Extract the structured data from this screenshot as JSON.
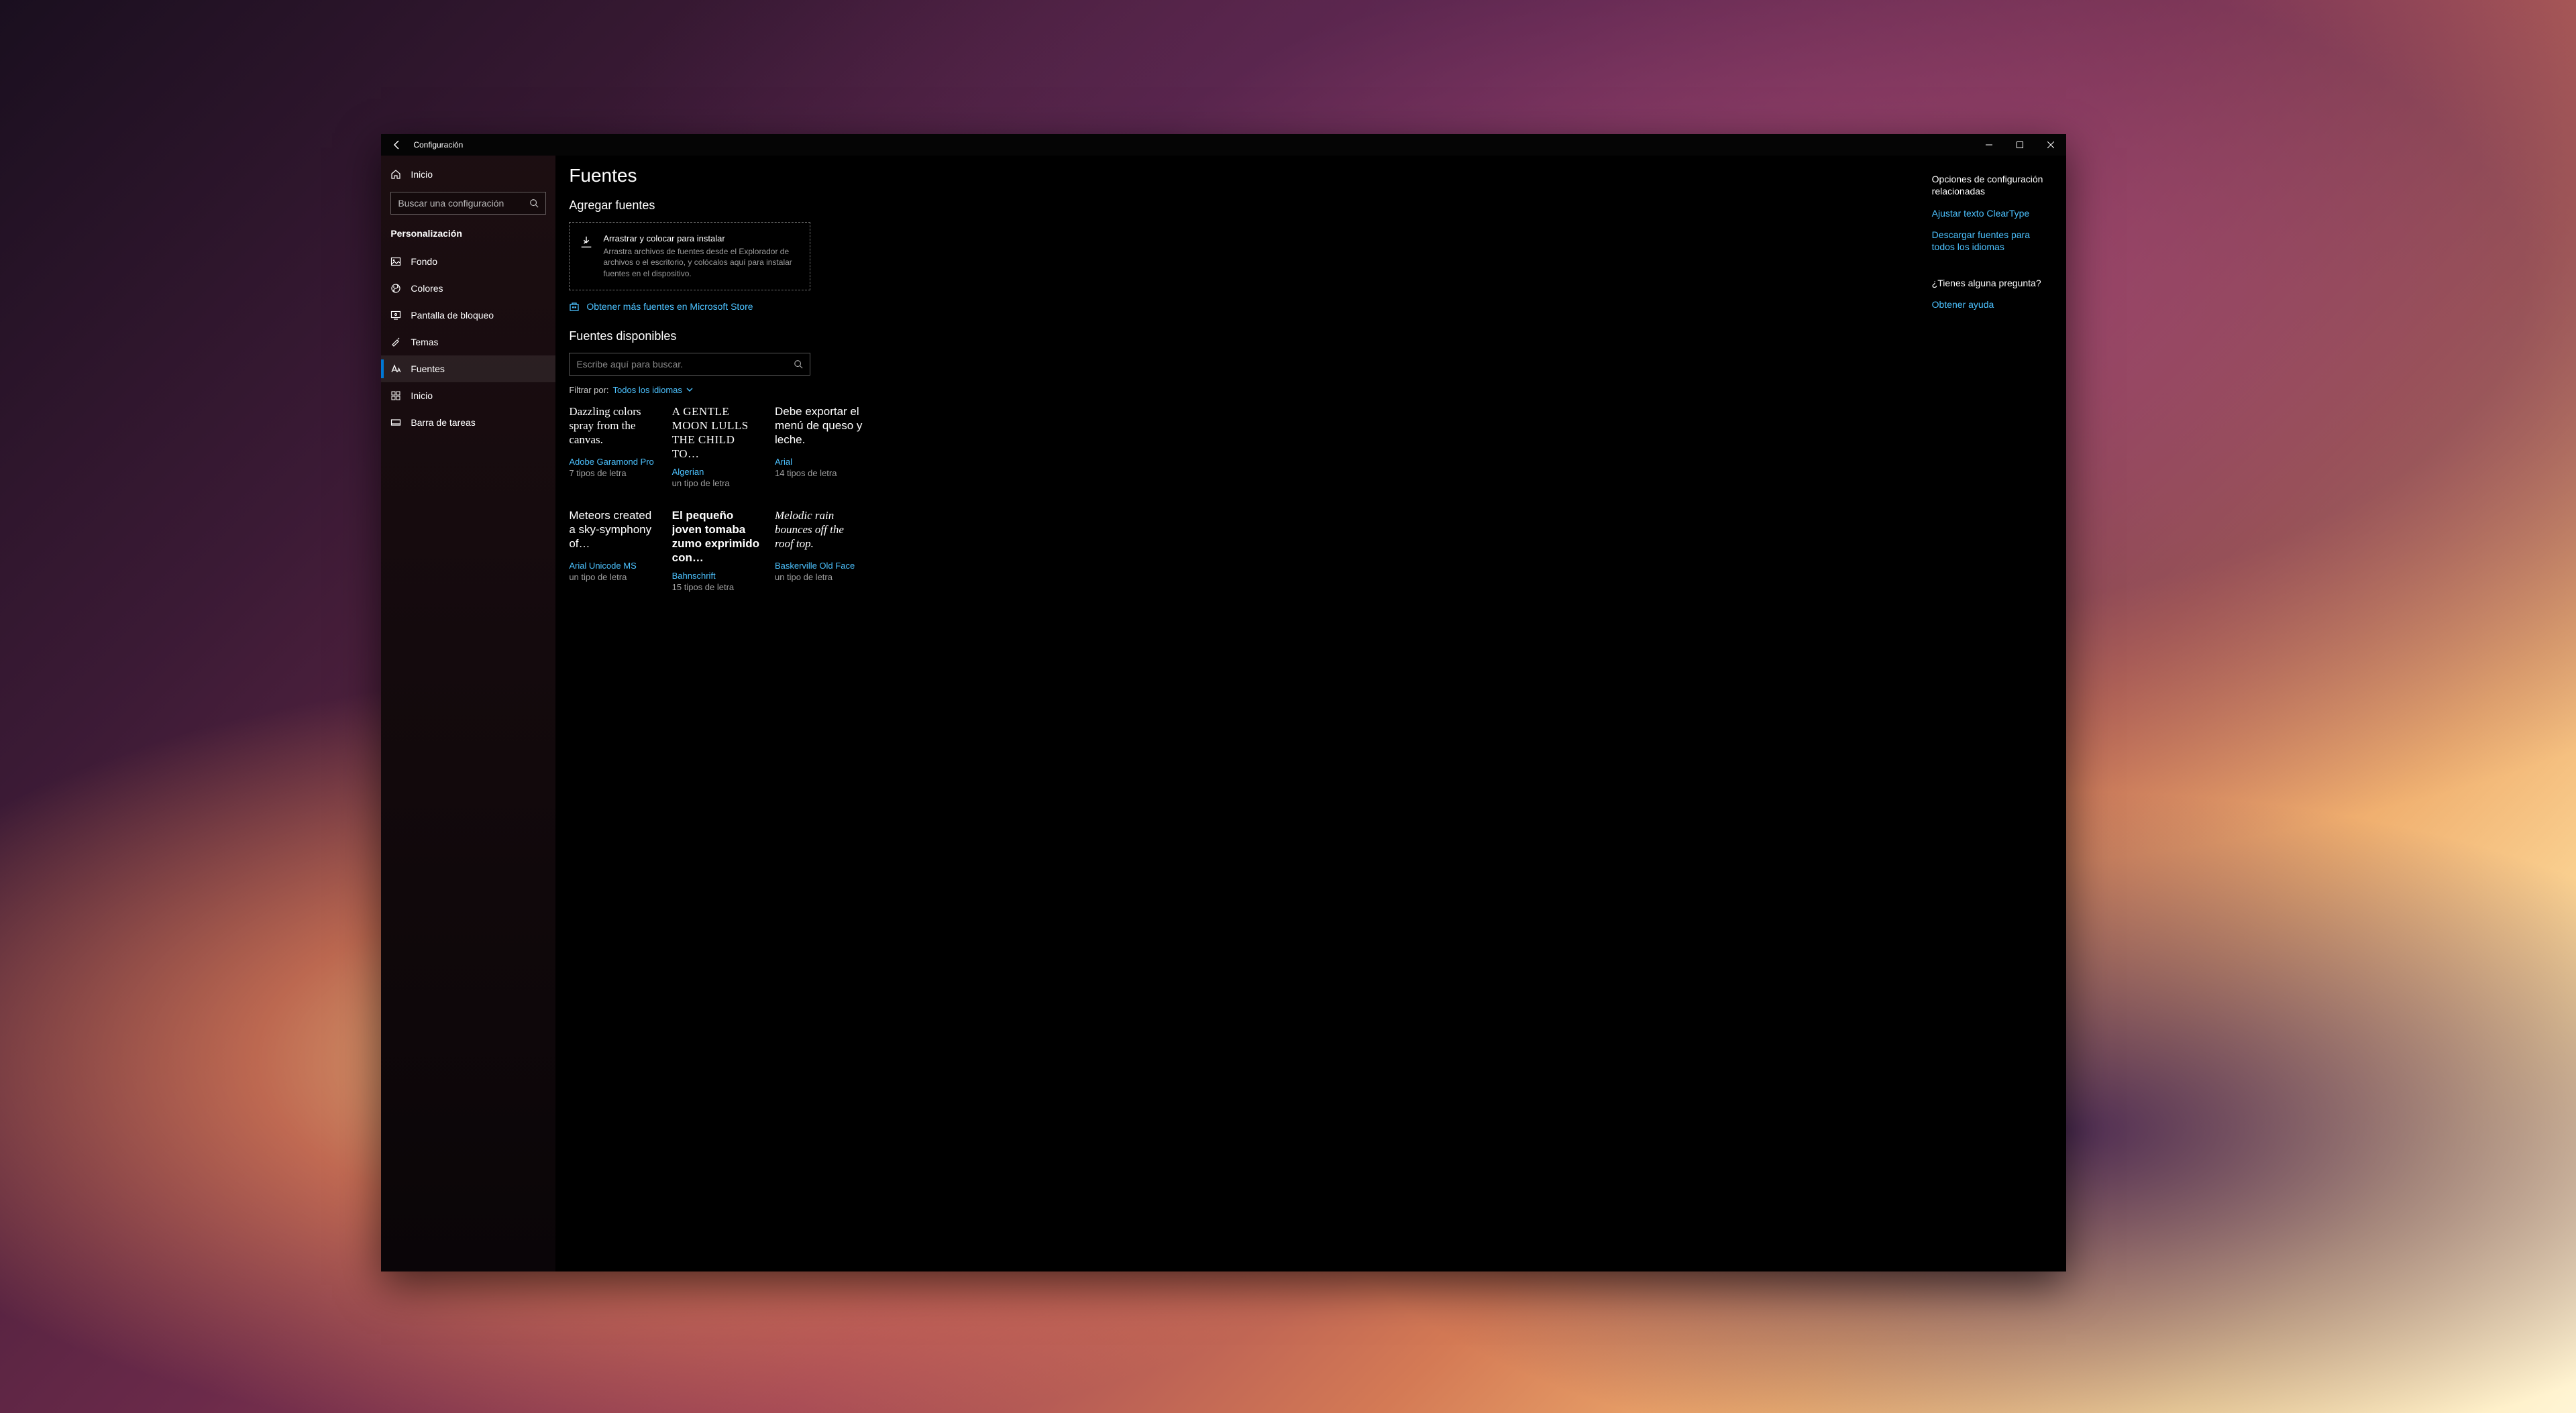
{
  "window": {
    "title": "Configuración"
  },
  "sidebar": {
    "home": "Inicio",
    "search_placeholder": "Buscar una configuración",
    "section": "Personalización",
    "items": [
      {
        "id": "fondo",
        "label": "Fondo"
      },
      {
        "id": "colores",
        "label": "Colores"
      },
      {
        "id": "pantalla",
        "label": "Pantalla de bloqueo"
      },
      {
        "id": "temas",
        "label": "Temas"
      },
      {
        "id": "fuentes",
        "label": "Fuentes"
      },
      {
        "id": "inicio",
        "label": "Inicio"
      },
      {
        "id": "taskbar",
        "label": "Barra de tareas"
      }
    ],
    "active": "fuentes"
  },
  "main": {
    "page_title": "Fuentes",
    "add_fonts_h": "Agregar fuentes",
    "drop_title": "Arrastrar y colocar para instalar",
    "drop_sub": "Arrastra archivos de fuentes desde el Explorador de archivos o el escritorio, y colócalos aquí para instalar fuentes en el dispositivo.",
    "store_link": "Obtener más fuentes en Microsoft Store",
    "available_h": "Fuentes disponibles",
    "font_search_placeholder": "Escribe aquí para buscar.",
    "filter_label": "Filtrar por:",
    "filter_value": "Todos los idiomas",
    "fonts": [
      {
        "sample": "Dazzling colors spray from the canvas.",
        "name": "Adobe Garamond Pro",
        "faces": "7 tipos de letra",
        "class": "ff-garamond"
      },
      {
        "sample": "A gentle moon lulls the child to…",
        "name": "Algerian",
        "faces": "un tipo de letra",
        "class": "ff-algerian"
      },
      {
        "sample": "Debe exportar el menú de queso y leche.",
        "name": "Arial",
        "faces": "14 tipos de letra",
        "class": "ff-arial"
      },
      {
        "sample": "Meteors created a sky-symphony of…",
        "name": "Arial Unicode MS",
        "faces": "un tipo de letra",
        "class": "ff-arialuni"
      },
      {
        "sample": "El pequeño joven tomaba zumo exprimido con…",
        "name": "Bahnschrift",
        "faces": "15 tipos de letra",
        "class": "ff-bahn"
      },
      {
        "sample": "Melodic rain bounces off the roof top.",
        "name": "Baskerville Old Face",
        "faces": "un tipo de letra",
        "class": "ff-basker"
      }
    ]
  },
  "aside": {
    "related_h": "Opciones de configuración relacionadas",
    "links": [
      "Ajustar texto ClearType",
      "Descargar fuentes para todos los idiomas"
    ],
    "question_h": "¿Tienes alguna pregunta?",
    "help_link": "Obtener ayuda"
  }
}
